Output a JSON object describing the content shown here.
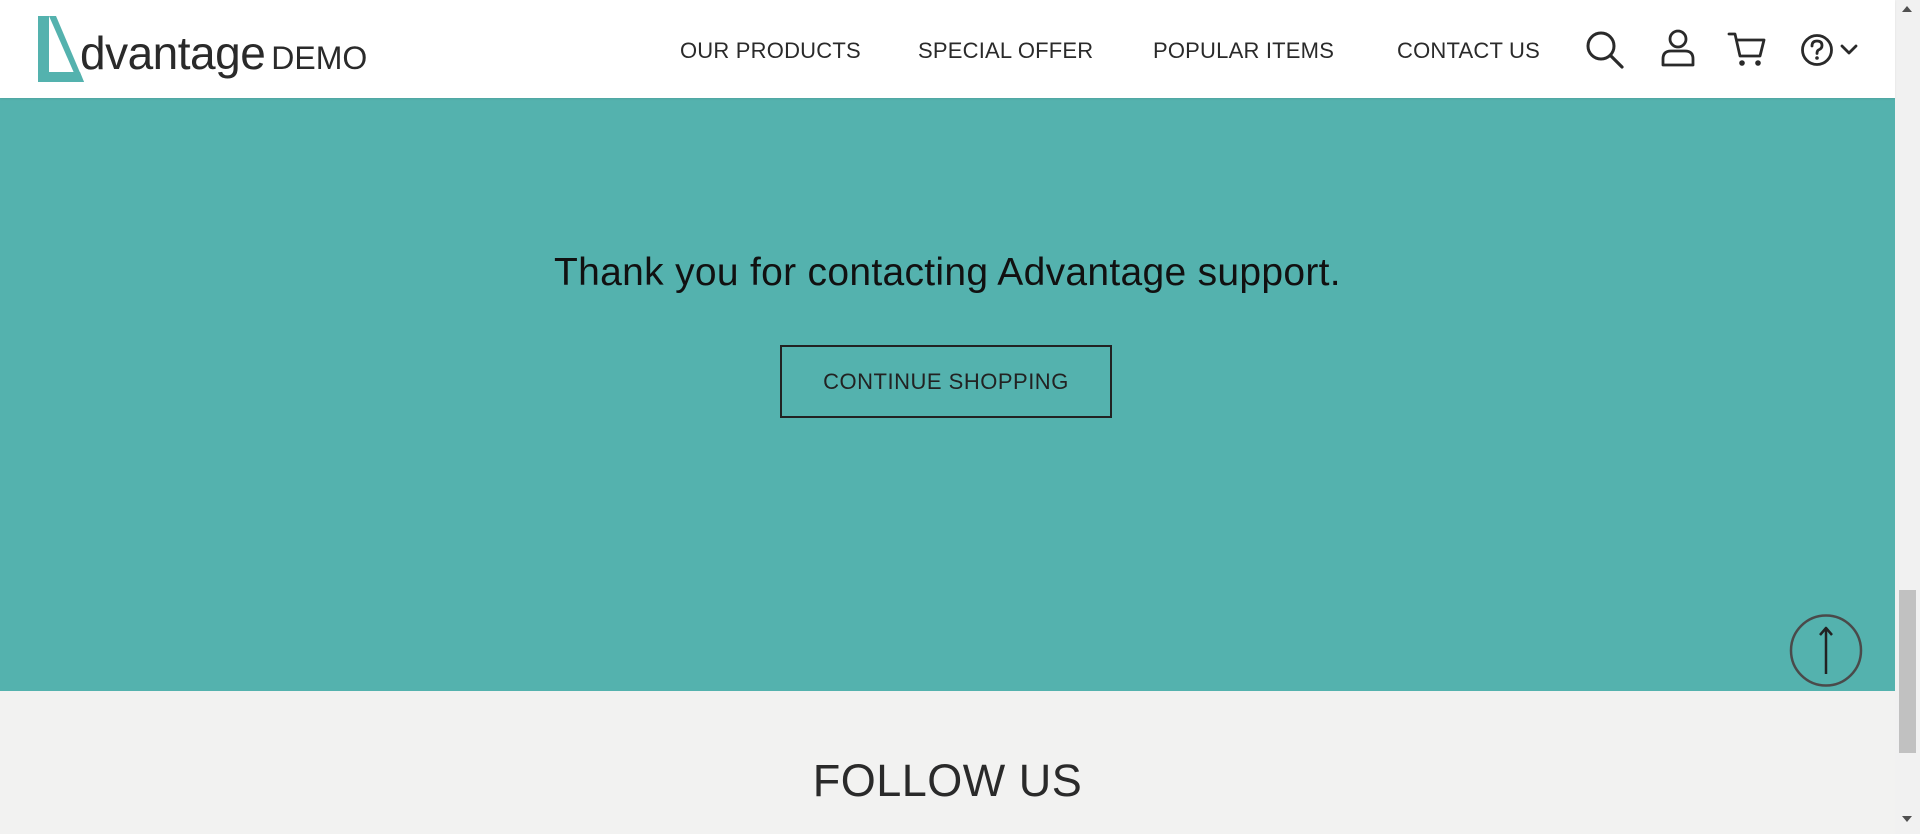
{
  "brand": {
    "mark": "A",
    "name": "dvantage",
    "suffix": "DEMO",
    "accent": "#54b2ae"
  },
  "nav": {
    "items": [
      {
        "label": "OUR PRODUCTS"
      },
      {
        "label": "SPECIAL OFFER"
      },
      {
        "label": "POPULAR ITEMS"
      },
      {
        "label": "CONTACT US"
      }
    ],
    "icons": [
      "search-icon",
      "user-icon",
      "cart-icon",
      "help-icon",
      "chevron-down-icon"
    ]
  },
  "hero": {
    "message": "Thank you for contacting Advantage support.",
    "button_label": "CONTINUE SHOPPING",
    "background": "#54b2ae"
  },
  "footer": {
    "follow_title": "FOLLOW US"
  }
}
